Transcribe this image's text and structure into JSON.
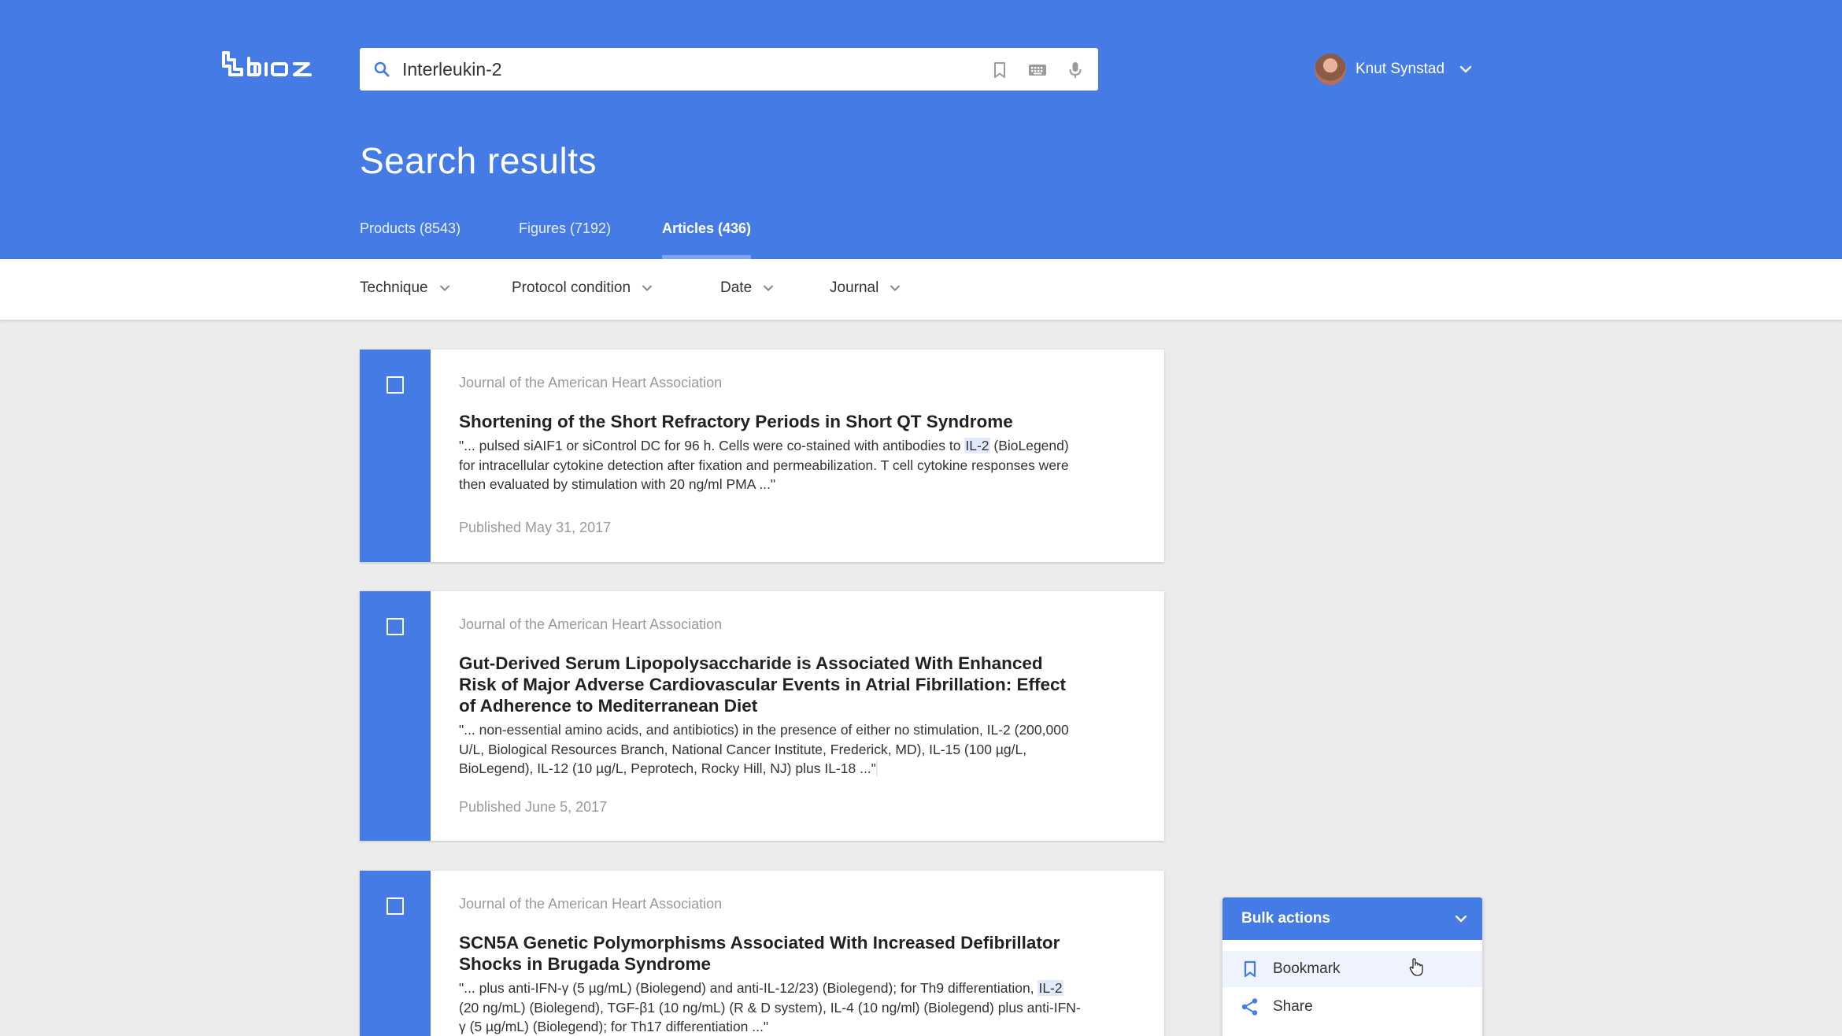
{
  "brand": {
    "logo_text": "bioz",
    "accent": "#457be4",
    "highlight": "#e1eafb"
  },
  "search": {
    "value": "Interleukin-2",
    "placeholder": "Search",
    "tools": [
      "bookmark-icon",
      "keyboard-icon",
      "microphone-icon"
    ]
  },
  "user": {
    "name": "Knut Synstad"
  },
  "page": {
    "title": "Search results"
  },
  "tabs": [
    {
      "label": "Products (8543)",
      "active": false
    },
    {
      "label": "Figures (7192)",
      "active": false
    },
    {
      "label": "Articles (436)",
      "active": true
    }
  ],
  "filters": [
    {
      "label": "Technique"
    },
    {
      "label": "Protocol condition"
    },
    {
      "label": "Date"
    },
    {
      "label": "Journal"
    }
  ],
  "results": [
    {
      "journal": "Journal of the American Heart Association",
      "title": "Shortening of the Short Refractory Periods in Short QT Syndrome",
      "snippet_before": "\"... pulsed siAIF1 or siControl DC for 96 h. Cells were co-stained with antibodies to ",
      "snippet_highlight": "IL-2",
      "snippet_after": " (BioLegend) for intracellular cytokine detection after fixation and permeabilization. T cell cytokine responses were then evaluated by stimulation with 20 ng/ml PMA ...\"",
      "published": "Published May 31, 2017"
    },
    {
      "journal": "Journal of the American Heart Association",
      "title": "Gut-Derived Serum Lipopolysaccharide is Associated With Enhanced Risk of Major Adverse Cardiovascular Events in Atrial Fibrillation: Effect of Adherence to Mediterranean Diet",
      "snippet_before": "\"... non-essential amino acids, and antibiotics) in the presence of either no stimulation, IL-2 (200,000 U/L, Biological Resources Branch, National Cancer Institute, Frederick, MD), IL-15 (100 µg/L, BioLegend), IL-12 (10 µg/L, Peprotech, Rocky Hill, NJ) plus IL-18 ...\"",
      "snippet_highlight": "",
      "snippet_after": "",
      "published": "Published June 5, 2017"
    },
    {
      "journal": "Journal of the American Heart Association",
      "title": "SCN5A Genetic Polymorphisms Associated With Increased Defibrillator Shocks in Brugada Syndrome",
      "snippet_before": "\"... plus anti-IFN-γ (5 µg/mL) (Biolegend) and anti-IL-12/23) (Biolegend); for Th9 differentiation, ",
      "snippet_highlight": "IL-2",
      "snippet_after": " (20 ng/mL) (Biolegend), TGF-β1 (10 ng/mL) (R & D system), IL-4 (10 ng/ml) (Biolegend) plus anti-IFN-γ (5 µg/mL) (Biolegend); for Th17 differentiation ...\"",
      "published": ""
    }
  ],
  "bulk_actions": {
    "label": "Bulk actions",
    "items": [
      {
        "label": "Bookmark",
        "icon": "bookmark-icon"
      },
      {
        "label": "Share",
        "icon": "share-icon"
      }
    ]
  }
}
